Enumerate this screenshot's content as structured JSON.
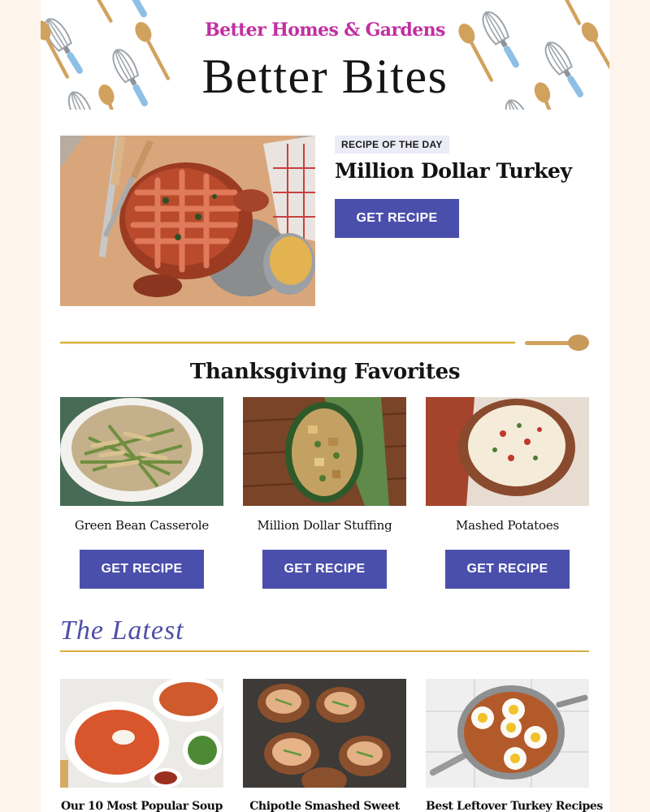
{
  "colors": {
    "page_bg": "#fdf5ec",
    "brand_magenta": "#c02fa0",
    "button_indigo": "#4b4fac",
    "gold_rule": "#d8b03c",
    "tag_bg": "#ececf8",
    "latest_indigo": "#4e4ea7"
  },
  "header": {
    "brand_name": "Better Homes & Gardens",
    "newsletter_title": "Better Bites",
    "decor_icons": [
      "whisk-icon",
      "wooden-spoon-icon"
    ]
  },
  "hero": {
    "tag": "RECIPE OF THE DAY",
    "title": "Million Dollar Turkey",
    "button": "GET RECIPE",
    "image": "roast-turkey-photo"
  },
  "favorites": {
    "title": "Thanksgiving Favorites",
    "cards": [
      {
        "label": "Green Bean Casserole",
        "button": "GET RECIPE",
        "image": "green-bean-casserole-photo"
      },
      {
        "label": "Million Dollar Stuffing",
        "button": "GET RECIPE",
        "image": "stuffing-photo"
      },
      {
        "label": "Mashed Potatoes",
        "button": "GET RECIPE",
        "image": "mashed-potatoes-photo"
      }
    ]
  },
  "latest": {
    "title": "The Latest",
    "items": [
      {
        "label": "Our 10 Most Popular Soup",
        "image": "soup-bowls-photo"
      },
      {
        "label": "Chipotle Smashed Sweet",
        "image": "smashed-sweet-potatoes-photo"
      },
      {
        "label": "Best Leftover Turkey Recipes",
        "image": "turkey-hash-skillet-photo"
      }
    ]
  }
}
